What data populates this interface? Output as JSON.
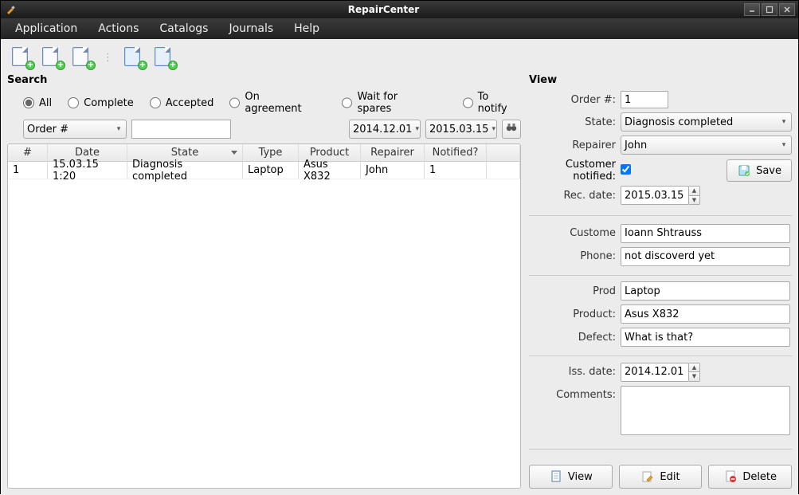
{
  "titlebar": {
    "title": "RepairCenter"
  },
  "menu": {
    "items": [
      "Application",
      "Actions",
      "Catalogs",
      "Journals",
      "Help"
    ]
  },
  "search": {
    "title": "Search",
    "radios": {
      "all": "All",
      "complete": "Complete",
      "accepted": "Accepted",
      "on_agreement": "On agreement",
      "wait_spares": "Wait for spares",
      "to_notify": "To notify"
    },
    "field_combo": "Order #",
    "date_from": "2014.12.01",
    "date_to": "2015.03.15"
  },
  "table": {
    "headers": {
      "num": "#",
      "date": "Date",
      "state": "State",
      "type": "Type",
      "product": "Product",
      "repairer": "Repairer",
      "notified": "Notified?"
    },
    "rows": [
      {
        "num": "1",
        "date": "15.03.15 1:20",
        "state": "Diagnosis completed",
        "type": "Laptop",
        "product": "Asus X832",
        "repairer": "John",
        "notified": "1"
      }
    ]
  },
  "view": {
    "title": "View",
    "labels": {
      "order": "Order #:",
      "state": "State:",
      "repairer": "Repairer",
      "notified": "Customer notified:",
      "rec_date": "Rec. date:",
      "customer": "Custome",
      "phone": "Phone:",
      "prodtype": "Prod",
      "product": "Product:",
      "defect": "Defect:",
      "iss_date": "Iss. date:",
      "comments": "Comments:"
    },
    "values": {
      "order": "1",
      "state": "Diagnosis completed",
      "repairer": "John",
      "rec_date": "2015.03.15",
      "customer": "Ioann Shtrauss",
      "phone": "not discoverd yet",
      "prodtype": "Laptop",
      "product": "Asus X832",
      "defect": "What is that?",
      "iss_date": "2014.12.01",
      "comments": ""
    },
    "buttons": {
      "save": "Save",
      "view": "View",
      "edit": "Edit",
      "delete": "Delete"
    }
  }
}
